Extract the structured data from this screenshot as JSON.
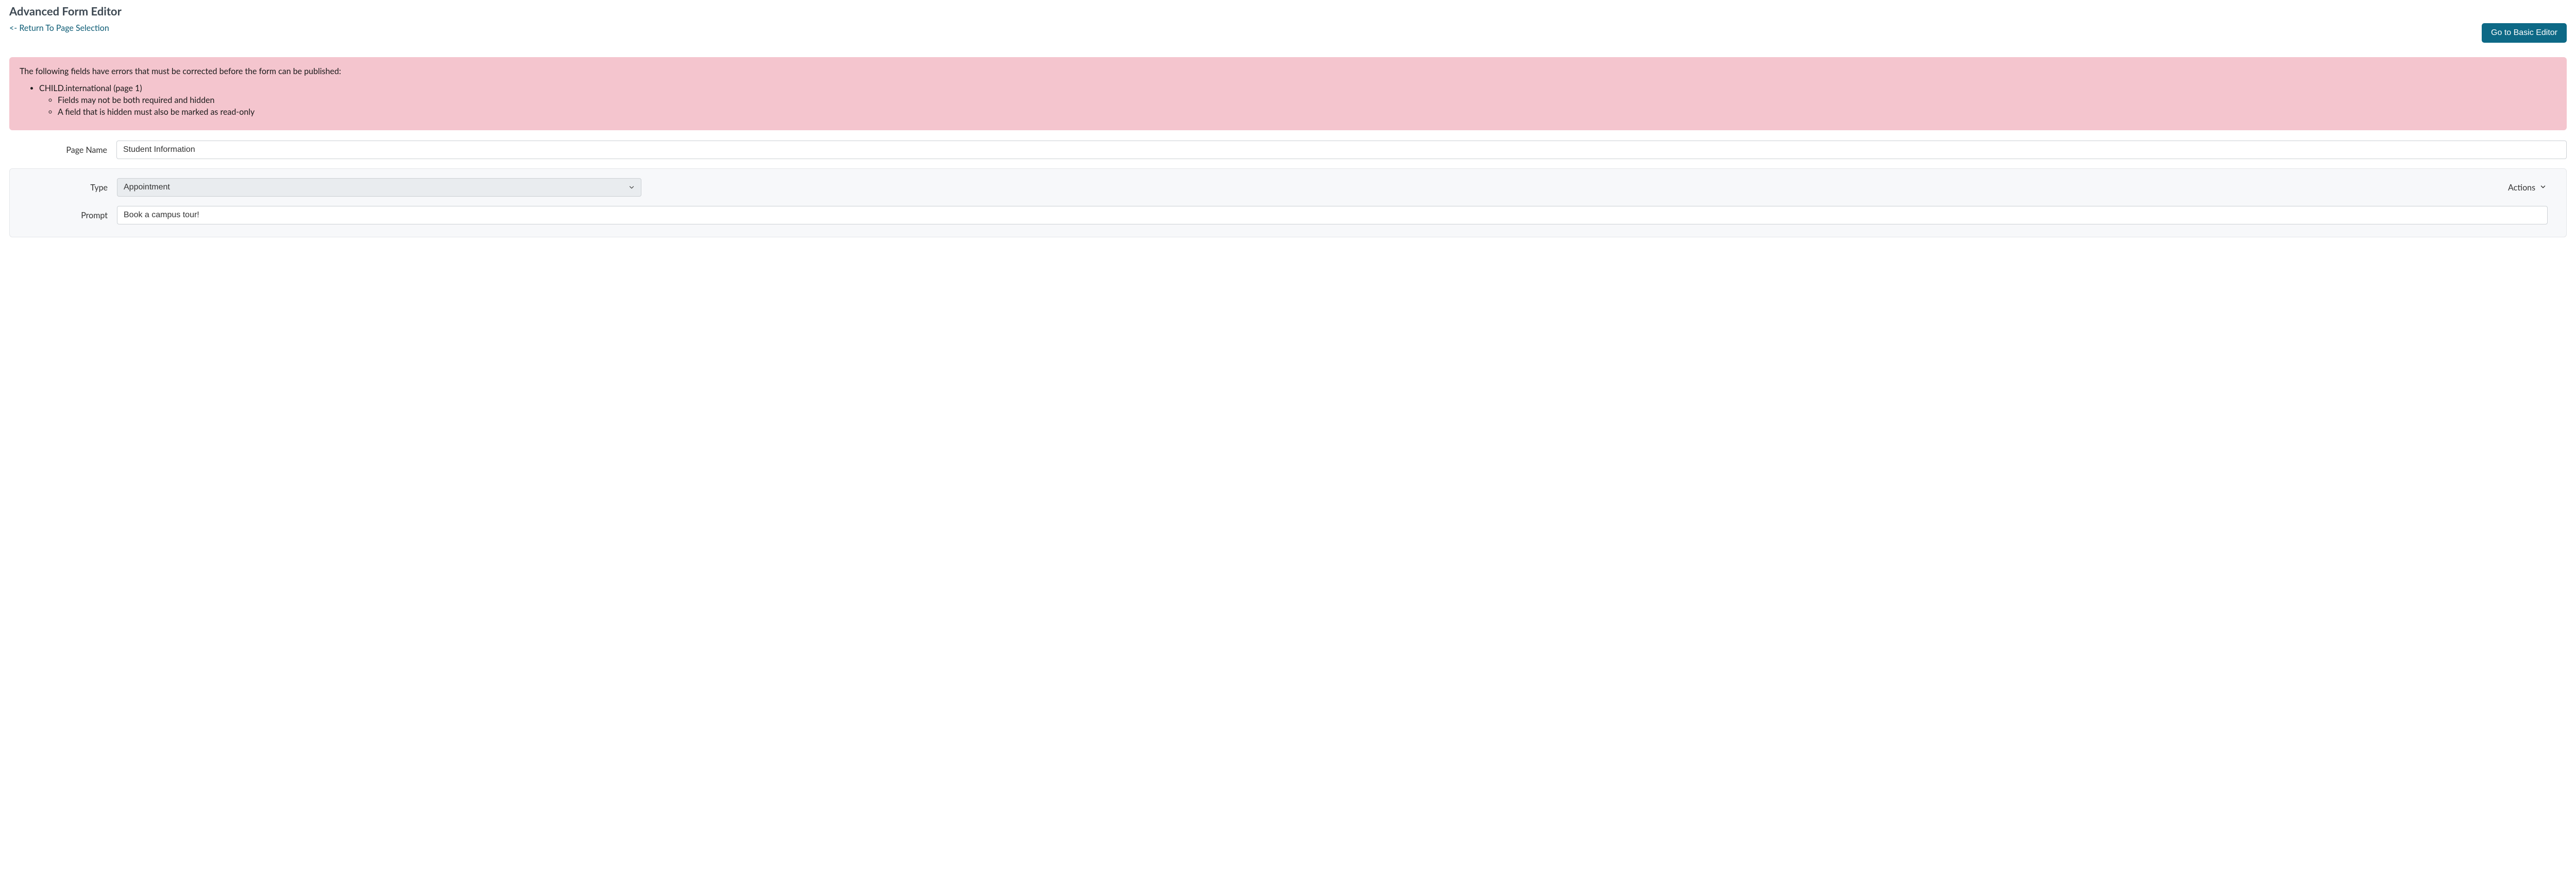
{
  "header": {
    "title": "Advanced Form Editor",
    "return_link": "<- Return To Page Selection",
    "basic_editor_button": "Go to Basic Editor"
  },
  "errors": {
    "intro": "The following fields have errors that must be corrected before the form can be published:",
    "field_name": "CHILD.international (page 1)",
    "messages": [
      "Fields may not be both required and hidden",
      "A field that is hidden must also be marked as read-only"
    ]
  },
  "form": {
    "page_name_label": "Page Name",
    "page_name_value": "Student Information"
  },
  "field_config": {
    "type_label": "Type",
    "type_value": "Appointment",
    "actions_label": "Actions",
    "prompt_label": "Prompt",
    "prompt_value": "Book a campus tour!"
  }
}
